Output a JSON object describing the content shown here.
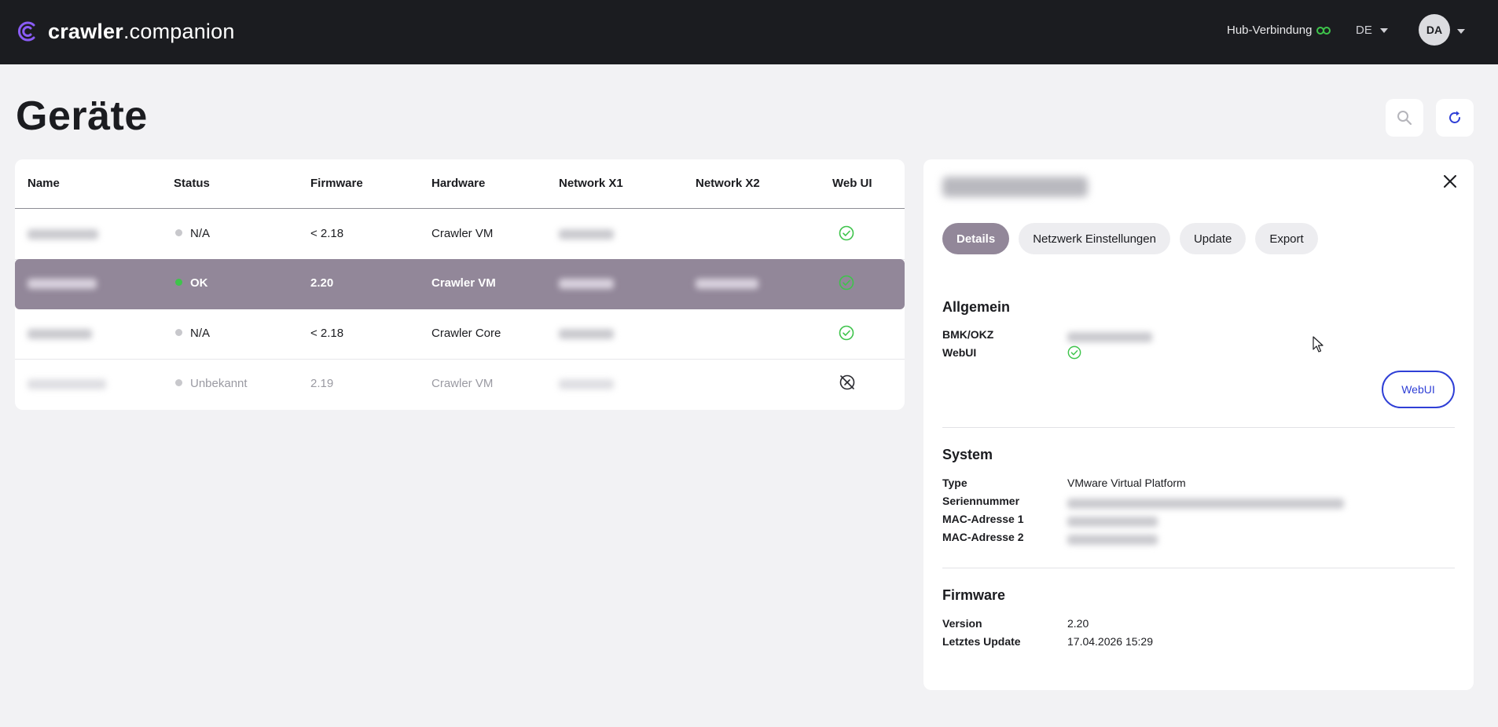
{
  "header": {
    "brand_bold": "crawler",
    "brand_rest": ".companion",
    "hub_label": "Hub-Verbindung",
    "language": "DE",
    "avatar_initials": "DA",
    "accent_color": "#8a5cf6"
  },
  "page": {
    "title": "Geräte",
    "search_icon": "search-icon",
    "refresh_icon": "refresh-icon"
  },
  "table": {
    "columns": [
      "Name",
      "Status",
      "Firmware",
      "Hardware",
      "Network X1",
      "Network X2",
      "Web UI"
    ],
    "rows": [
      {
        "status": "N/A",
        "status_color": "#c8c8cc",
        "firmware": "< 2.18",
        "hardware": "Crawler VM",
        "webui": "check-circle-icon"
      },
      {
        "status": "OK",
        "status_color": "#3ec44b",
        "firmware": "2.20",
        "hardware": "Crawler VM",
        "webui": "check-circle-icon",
        "selected": true
      },
      {
        "status": "N/A",
        "status_color": "#c8c8cc",
        "firmware": "< 2.18",
        "hardware": "Crawler Core",
        "webui": "check-circle-icon"
      },
      {
        "status": "Unbekannt",
        "status_color": "#c8c8cc",
        "firmware": "2.19",
        "hardware": "Crawler VM",
        "webui": "link-off-icon"
      }
    ]
  },
  "panel": {
    "tabs": [
      "Details",
      "Netzwerk Einstellungen",
      "Update",
      "Export"
    ],
    "active_tab": "Details",
    "general": {
      "title": "Allgemein",
      "bmk_label": "BMK/OKZ",
      "webui_label": "WebUI",
      "webui_button": "WebUI"
    },
    "system": {
      "title": "System",
      "type_label": "Type",
      "type_value": "VMware Virtual Platform",
      "serial_label": "Seriennummer",
      "mac1_label": "MAC-Adresse 1",
      "mac2_label": "MAC-Adresse 2"
    },
    "firmware": {
      "title": "Firmware",
      "version_label": "Version",
      "version_value": "2.20",
      "last_update_label": "Letztes Update",
      "last_update_value": "17.04.2026 15:29"
    }
  }
}
